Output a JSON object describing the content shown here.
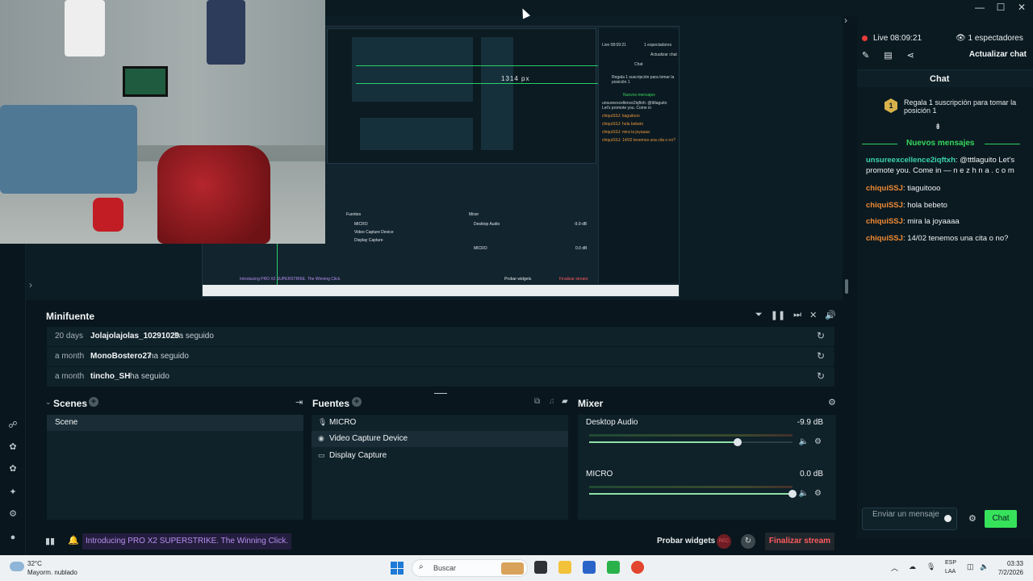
{
  "window": {
    "controls": {
      "minimize": "—",
      "maximize": "☐",
      "close": "✕"
    }
  },
  "preview": {
    "measure_label": "1314 px",
    "nested_chat": {
      "live": "Live 08:09:21",
      "viewers": "1 espectadores",
      "refresh": "Actualizar chat",
      "chat": "Chat",
      "sub": "Regala 1 suscripción para tomar la posición 1",
      "new_messages": "Nuevos mensajes",
      "messages": [
        "unsureexcellence2iqftxh: @tttlaguito Let's promote you. Come in",
        "chiquiSSJ: tiaguitooo",
        "chiquiSSJ: hola bebeto",
        "chiquiSSJ: mira la joyaaaa",
        "chiquiSSJ: 14/02 tenemos una cita o no?"
      ]
    },
    "nested_mixer": {
      "fuentes": "Fuentes",
      "mixer": "Mixer",
      "desktop": "Desktop Audio",
      "desktop_db": "-9.9 dB",
      "micro": "MICRO",
      "micro_db": "0.0 dB"
    },
    "nested_sources": [
      "MICRO",
      "Video Capture Device",
      "Display Capture"
    ],
    "nested_promo": "Introducing PRO X2 SUPERSTRIKE. The Winning Click.",
    "nested_footer": {
      "probar": "Probar widgets",
      "end": "Finalizar stream"
    }
  },
  "minifuente": {
    "title": "Minifuente",
    "rows": [
      {
        "time": "20 days",
        "user": "Jolajolajolas_10291029",
        "action": "ha seguido"
      },
      {
        "time": "a month",
        "user": "MonoBostero27",
        "action": "ha seguido"
      },
      {
        "time": "a month",
        "user": "tincho_SH",
        "action": "ha seguido"
      }
    ]
  },
  "scenes": {
    "title": "Scenes",
    "items": [
      "Scene"
    ]
  },
  "sources": {
    "title": "Fuentes",
    "items": [
      {
        "label": "MICRO",
        "icon": "microphone-icon"
      },
      {
        "label": "Video Capture Device",
        "icon": "webcam-icon"
      },
      {
        "label": "Display Capture",
        "icon": "monitor-icon"
      }
    ]
  },
  "mixer": {
    "title": "Mixer",
    "channels": [
      {
        "name": "Desktop Audio",
        "db": "-9.9 dB",
        "level": 0.73
      },
      {
        "name": "MICRO",
        "db": "0.0 dB",
        "level": 1.0
      }
    ]
  },
  "footer": {
    "promo": "Introducing PRO X2 SUPERSTRIKE. The Winning Click.",
    "probar": "Probar widgets",
    "rec": "REC",
    "end_stream": "Finalizar stream"
  },
  "chat": {
    "live": "Live 08:09:21",
    "viewers": "1 espectadores",
    "refresh": "Actualizar chat",
    "header": "Chat",
    "sub_rank": "1",
    "sub_text": "Regala 1 suscripción para tomar la posición 1",
    "new_messages": "Nuevos mensajes",
    "messages": [
      {
        "nick": "unsureexcellence2iqftxh",
        "text": ": @tttlaguito Let's promote you. Come in — n e z h n a . c o m",
        "color": "#3bd4b0"
      },
      {
        "nick": "chiquiSSJ",
        "text": ": tiaguitooo",
        "color": "#f08a34"
      },
      {
        "nick": "chiquiSSJ",
        "text": ": hola bebeto",
        "color": "#f08a34"
      },
      {
        "nick": "chiquiSSJ",
        "text": ": mira la joyaaaa",
        "color": "#f08a34"
      },
      {
        "nick": "chiquiSSJ",
        "text": ": 14/02 tenemos una cita o no?",
        "color": "#f08a34"
      }
    ],
    "input_placeholder": "Enviar un mensaje",
    "send": "Chat"
  },
  "taskbar": {
    "temp": "32°C",
    "weather": "Mayorm. nublado",
    "search": "Buscar",
    "lang1": "ESP",
    "lang2": "LAA",
    "time": "03:33",
    "date": "7/2/2026"
  },
  "colors": {
    "accent_green": "#37e25b",
    "live_red": "#e93b3b",
    "end_stream_red": "#ff5a5f",
    "promo_purple": "#b68ef0"
  }
}
